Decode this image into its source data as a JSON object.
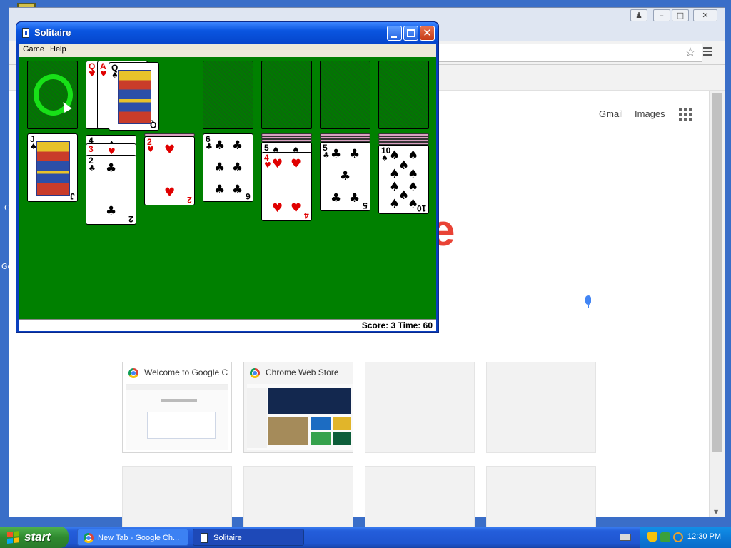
{
  "desktop": {
    "edge_text_1": "C",
    "edge_text_2": "Gc"
  },
  "chrome": {
    "page": {
      "gmail_link": "Gmail",
      "images_link": "Images",
      "apps_icon": "apps-grid-icon",
      "logo_fragment": "e"
    },
    "tiles": [
      {
        "title": "Welcome to Google C",
        "icon": "chrome-icon"
      },
      {
        "title": "Chrome Web Store",
        "icon": "chrome-web-store-icon"
      }
    ]
  },
  "solitaire": {
    "title": "Solitaire",
    "menu": [
      "Game",
      "Help"
    ],
    "status": "Score: 3 Time: 60",
    "waste": [
      {
        "rank": "Q",
        "suit": "♥",
        "color": "red"
      },
      {
        "rank": "A",
        "suit": "♥",
        "color": "red"
      },
      {
        "rank": "Q",
        "suit": "♠",
        "color": "black"
      }
    ],
    "tableau": [
      {
        "rank": "J",
        "suit": "♠",
        "color": "black"
      },
      {
        "rank": "2",
        "suit": "♣",
        "color": "black",
        "under": [
          {
            "rank": "4",
            "suit": "♠"
          },
          {
            "rank": "3",
            "suit": "♥"
          }
        ]
      },
      {
        "rank": "2",
        "suit": "♥",
        "color": "red"
      },
      {
        "rank": "6",
        "suit": "♣",
        "color": "black"
      },
      {
        "rank": "4",
        "suit": "♥",
        "color": "red",
        "under": [
          {
            "rank": "5",
            "suit": "♠"
          }
        ]
      },
      {
        "rank": "5",
        "suit": "♣",
        "color": "black"
      },
      {
        "rank": "10",
        "suit": "♠",
        "color": "black"
      }
    ]
  },
  "taskbar": {
    "start_label": "start",
    "tasks": [
      {
        "label": "New Tab - Google Ch...",
        "icon": "chrome-icon"
      },
      {
        "label": "Solitaire",
        "icon": "solitaire-icon"
      }
    ],
    "clock": "12:30 PM"
  },
  "colors": {
    "felt": "#008000",
    "xp_title_blue": "#0a55e0",
    "google_red": "#e94335",
    "start_green": "#2f8a2f"
  }
}
